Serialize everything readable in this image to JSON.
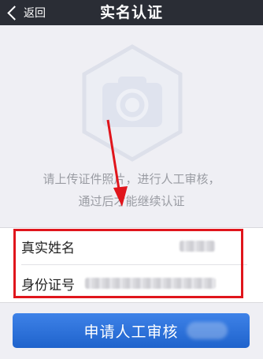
{
  "navbar": {
    "back_label": "返回",
    "title": "实名认证"
  },
  "hero": {
    "icon": "camera-icon"
  },
  "instruction": {
    "line1": "请上传证件照片，进行人工审核，",
    "line2": "通过后才能继续认证"
  },
  "form": {
    "name_label": "真实姓名",
    "id_label": "身份证号"
  },
  "submit_label": "申请人工审核",
  "colors": {
    "navbar": "#2a2d35",
    "background": "#efeff4",
    "button": "#2f74dc",
    "annotation": "#e0151c"
  }
}
